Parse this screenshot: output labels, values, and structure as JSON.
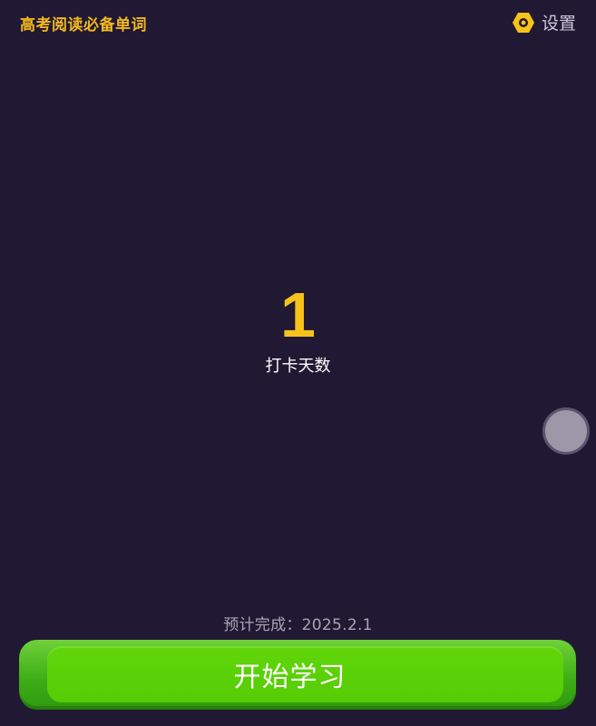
{
  "header": {
    "book_title": "高考阅读必备单词",
    "settings_label": "设置"
  },
  "streak": {
    "count": "1",
    "label": "打卡天数"
  },
  "footer": {
    "estimated_completion": "预计完成：2025.2.1",
    "start_button_label": "开始学习"
  },
  "colors": {
    "background": "#211833",
    "accent_gold": "#f7c31a",
    "button_green": "#55cc04"
  },
  "icons": {
    "settings": "gear-icon",
    "floating": "floating-assistant-ball"
  }
}
